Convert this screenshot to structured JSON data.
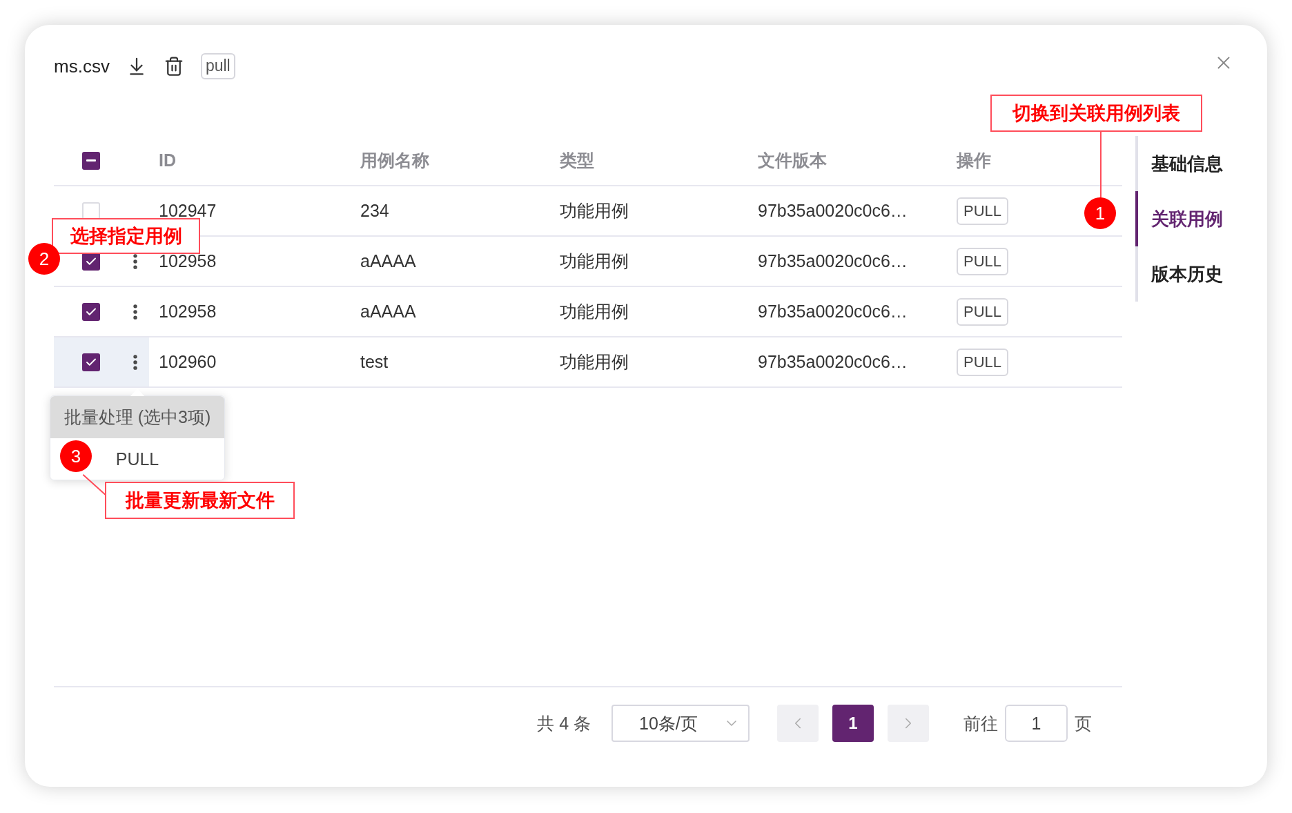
{
  "dialog": {
    "title": "ms.csv",
    "tag": "pull"
  },
  "table": {
    "header_indeterminate": true,
    "columns": [
      "ID",
      "用例名称",
      "类型",
      "文件版本",
      "操作"
    ],
    "rows": [
      {
        "checked": false,
        "highlighted": false,
        "id": "102947",
        "name": "234",
        "type": "功能用例",
        "version": "97b35a0020c0c6…",
        "action": "PULL"
      },
      {
        "checked": true,
        "highlighted": false,
        "id": "102958",
        "name": "aAAAA",
        "type": "功能用例",
        "version": "97b35a0020c0c6…",
        "action": "PULL"
      },
      {
        "checked": true,
        "highlighted": false,
        "id": "102958",
        "name": "aAAAA",
        "type": "功能用例",
        "version": "97b35a0020c0c6…",
        "action": "PULL"
      },
      {
        "checked": true,
        "highlighted": true,
        "id": "102960",
        "name": "test",
        "type": "功能用例",
        "version": "97b35a0020c0c6…",
        "action": "PULL"
      }
    ]
  },
  "batch_menu": {
    "title": "批量处理 (选中3项)",
    "items": [
      "PULL"
    ]
  },
  "side_tabs": [
    {
      "label": "基础信息",
      "selected": false
    },
    {
      "label": "关联用例",
      "selected": true
    },
    {
      "label": "版本历史",
      "selected": false
    }
  ],
  "pagination": {
    "total": "共 4 条",
    "page_size": "10条/页",
    "pages": [
      {
        "label": "1",
        "selected": true
      }
    ],
    "goto_label": "前往",
    "goto_value": "1",
    "goto_suffix": "页"
  },
  "annotations": [
    {
      "number": "1",
      "text": "切换到关联用例列表"
    },
    {
      "number": "2",
      "text": "选择指定用例"
    },
    {
      "number": "3",
      "text": "批量更新最新文件"
    }
  ]
}
